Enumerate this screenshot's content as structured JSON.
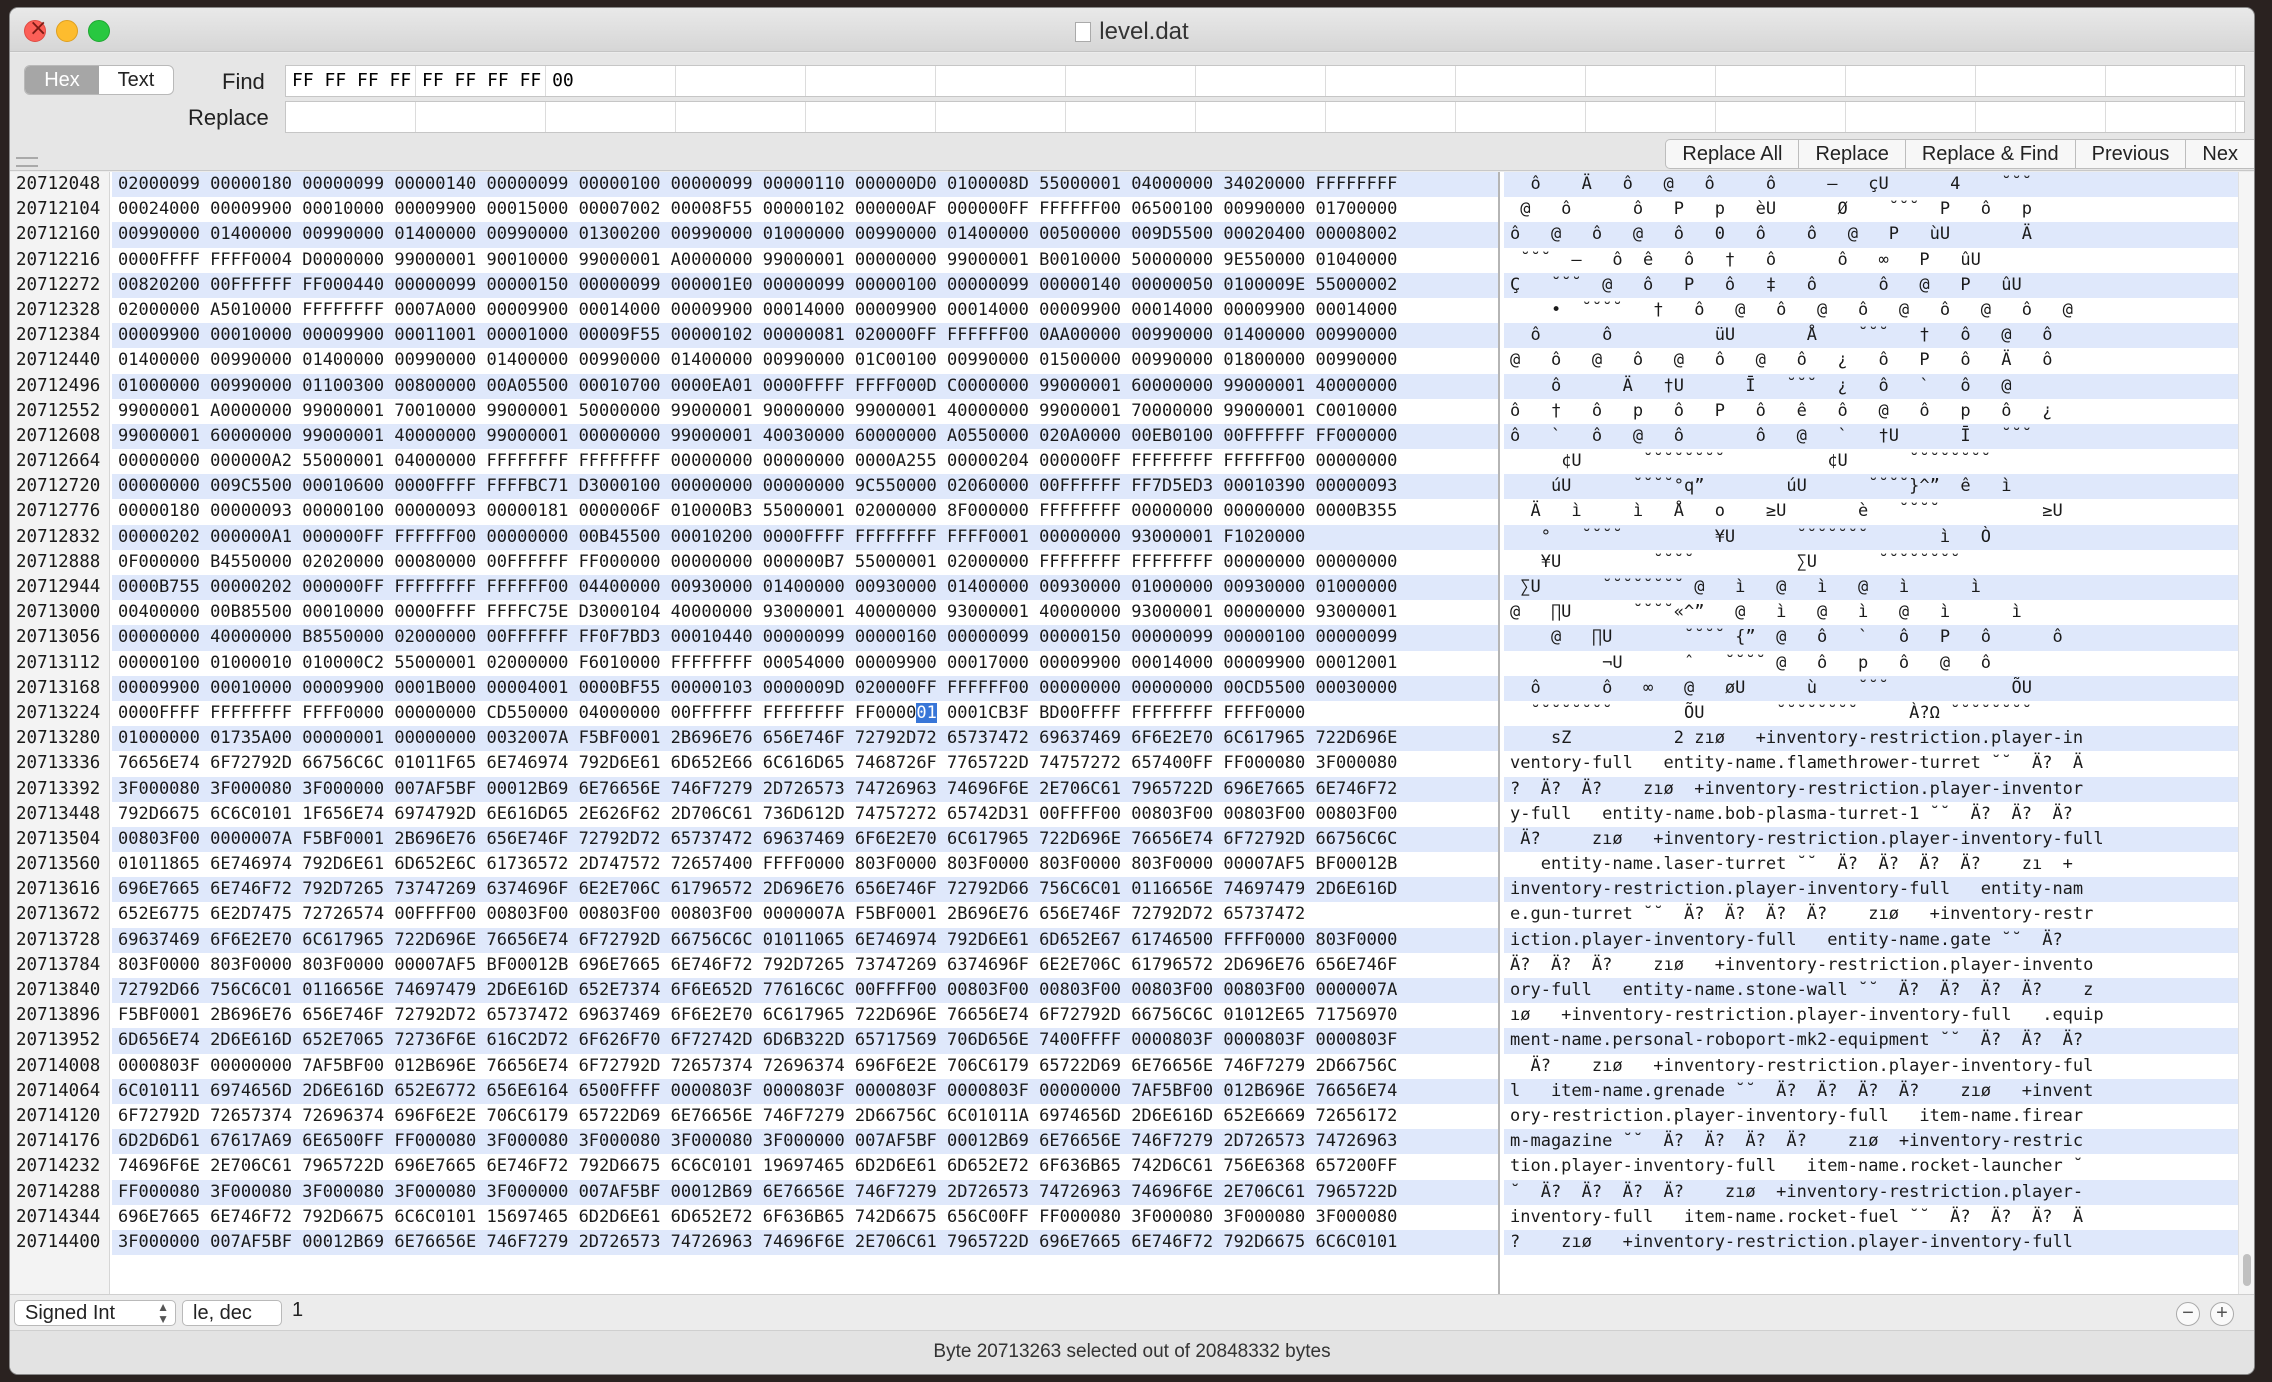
{
  "window": {
    "title": "level.dat"
  },
  "find": {
    "mode_hex": "Hex",
    "mode_text": "Text",
    "find_label": "Find",
    "find_value": "FF FF FF FF FF FF FF FF 00",
    "replace_label": "Replace",
    "replace_value": ""
  },
  "buttons": {
    "replace_all": "Replace All",
    "replace": "Replace",
    "replace_find": "Replace & Find",
    "previous": "Previous",
    "next": "Nex"
  },
  "rows": [
    {
      "o": "20712048",
      "h": "02000099 00000180 00000099 00000140 00000099 00000100 00000099 00000110 000000D0 0100008D 55000001 04000000 34020000 FFFFFFFF",
      "t": "  ô    Ä   ô   @   ô     ô     –   çU      4    ˘˘˘"
    },
    {
      "o": "20712104",
      "h": "00024000 00009900 00010000 00009900 00015000 00007002 00008F55 00000102 000000AF 000000FF FFFFFF00 06500100 00990000 01700000",
      "t": " @   ô      ô   P   p   èU      Ø    ˘˘˘  P   ô   p"
    },
    {
      "o": "20712160",
      "h": "00990000 01400000 00990000 01400000 00990000 01300200 00990000 01000000 00990000 01400000 00500000 009D5500 00020400 00008002",
      "t": "ô   @   ô   @   ô   0   ô    ô   @   P   ùU       Ä"
    },
    {
      "o": "20712216",
      "h": "0000FFFF FFFF0004 D0000000 99000001 90010000 99000001 A0000000 99000001 00000000 99000001 B0010000 50000000 9E550000 01040000",
      "t": " ˘˘˘  –   ô  ê   ô   †   ô      ô   ∞   P   ûU"
    },
    {
      "o": "20712272",
      "h": "00820200 00FFFFFF FF000440 00000099 00000150 00000099 000001E0 00000099 00000100 00000099 00000140 00000050 0100009E 55000002",
      "t": "Ç   ˘˘˘  @   ô   P   ô   ‡   ô      ô   @   P   ûU"
    },
    {
      "o": "20712328",
      "h": "02000000 A5010000 FFFFFFFF 0007A000 00009900 00014000 00009900 00014000 00009900 00014000 00009900 00014000 00009900 00014000",
      "t": "    •  ˘˘˘˘   †   ô   @   ô   @   ô   @   ô   @   ô   @"
    },
    {
      "o": "20712384",
      "h": "00009900 00010000 00009900 00011001 00001000 00009F55 00000102 00000081 020000FF FFFFFF00 0AA00000 00990000 01400000 00990000",
      "t": "  ô      ô          üU       Å    ˘˘˘   †   ô   @   ô"
    },
    {
      "o": "20712440",
      "h": "01400000 00990000 01400000 00990000 01400000 00990000 01400000 00990000 01C00100 00990000 01500000 00990000 01800000 00990000",
      "t": "@   ô   @   ô   @   ô   @   ô   ¿   ô   P   ô   Ä   ô"
    },
    {
      "o": "20712496",
      "h": "01000000 00990000 01100300 00800000 00A05500 00010700 0000EA01 0000FFFF FFFF000D C0000000 99000001 60000000 99000001 40000000",
      "t": "    ô      Ä   †U      Ī   ˘˘˘  ¿   ô   `   ô   @"
    },
    {
      "o": "20712552",
      "h": "99000001 A0000000 99000001 70010000 99000001 50000000 99000001 90000000 99000001 40000000 99000001 70000000 99000001 C0010000",
      "t": "ô   †   ô   p   ô   P   ô   ê   ô   @   ô   p   ô   ¿"
    },
    {
      "o": "20712608",
      "h": "99000001 60000000 99000001 40000000 99000001 00000000 99000001 40030000 60000000 A0550000 020A0000 00EB0100 00FFFFFF FF000000",
      "t": "ô   `   ô   @   ô       ô   @   `   †U      Ī   ˘˘˘"
    },
    {
      "o": "20712664",
      "h": "00000000 000000A2 55000001 04000000 FFFFFFFF FFFFFFFF 00000000 00000000 0000A255 00000204 000000FF FFFFFFFF FFFFFF00 00000000",
      "t": "     ¢U      ˘˘˘˘˘˘˘˘          ¢U      ˘˘˘˘˘˘˘˘"
    },
    {
      "o": "20712720",
      "h": "00000000 009C5500 00010600 0000FFFF FFFFBC71 D3000100 00000000 00000000 9C550000 02060000 00FFFFFF FF7D5ED3 00010390 00000093",
      "t": "    úU      ˘˘˘˘°q”        úU      ˘˘˘˘}^”  ê   ì"
    },
    {
      "o": "20712776",
      "h": "00000180 00000093 00000100 00000093 00000181 0000006F 010000B3 55000001 02000000 8F000000 FFFFFFFF 00000000 00000000 0000B355",
      "t": "  Ä   ì     ì   Å   o    ≥U       è   ˘˘˘˘          ≥U"
    },
    {
      "o": "20712832",
      "h": "00000202 000000A1 000000FF FFFFFF00 00000000 00B45500 00010200 0000FFFF FFFFFFFF FFFF0001 00000000 93000001 F1020000",
      "t": "   °   ˘˘˘˘         ¥U      ˘˘˘˘˘˘˘       ì   Ò"
    },
    {
      "o": "20712888",
      "h": "0F000000 B4550000 02020000 00080000 00FFFFFF FF000000 00000000 000000B7 55000001 02000000 FFFFFFFF FFFFFFFF 00000000 00000000",
      "t": "   ¥U         ˘˘˘˘          ∑U      ˘˘˘˘˘˘˘˘"
    },
    {
      "o": "20712944",
      "h": "0000B755 00000202 000000FF FFFFFFFF FFFFFF00 04400000 00930000 01400000 00930000 01400000 00930000 01000000 00930000 01000000",
      "t": " ∑U      ˘˘˘˘˘˘˘˘ @   ì   @   ì   @   ì      ì"
    },
    {
      "o": "20713000",
      "h": "00400000 00B85500 00010000 0000FFFF FFFFC75E D3000104 40000000 93000001 40000000 93000001 40000000 93000001 00000000 93000001",
      "t": "@   ∏U      ˘˘˘˘«^”   @   ì   @   ì   @   ì      ì"
    },
    {
      "o": "20713056",
      "h": "00000000 40000000 B8550000 02000000 00FFFFFF FF0F7BD3 00010440 00000099 00000160 00000099 00000150 00000099 00000100 00000099",
      "t": "    @   ∏U       ˘˘˘˘ {”  @   ô   `   ô   P   ô      ô"
    },
    {
      "o": "20713112",
      "h": "00000100 01000010 010000C2 55000001 02000000 F6010000 FFFFFFFF 00054000 00009900 00017000 00009900 00014000 00009900 00012001",
      "t": "         ¬U      ˆ   ˘˘˘˘ @   ô   p   ô   @   ô"
    },
    {
      "o": "20713168",
      "h": "00009900 00010000 00009900 0001B000 00004001 0000BF55 00000103 0000009D 020000FF FFFFFF00 00000000 00000000 00CD5500 00030000",
      "t": "  ô      ô   ∞   @   øU      ù    ˘˘˘            ÕU"
    },
    {
      "o": "20713224",
      "h": "0000FFFF FFFFFFFF FFFF0000 00000000 CD550000 04000000 00FFFFFF FFFFFFFF FF0000|01| 0001CB3F BD00FFFF FFFFFFFF FFFF0000",
      "t": "  ˘˘˘˘˘˘˘˘       ÕU       ˘˘˘˘˘˘˘˘     À?Ω ˘˘˘˘˘˘˘˘"
    },
    {
      "o": "20713280",
      "h": "01000000 01735A00 00000001 00000000 0032007A F5BF0001 2B696E76 656E746F 72792D72 65737472 69637469 6F6E2E70 6C617965 722D696E",
      "t": "    sZ          2 zıø   +inventory-restriction.player-in"
    },
    {
      "o": "20713336",
      "h": "76656E74 6F72792D 66756C6C 01011F65 6E746974 792D6E61 6D652E66 6C616D65 7468726F 7765722D 74757272 657400FF FF000080 3F000080",
      "t": "ventory-full   entity-name.flamethrower-turret ˘˘  Ä?  Ä"
    },
    {
      "o": "20713392",
      "h": "3F000080 3F000080 3F000000 007AF5BF 00012B69 6E76656E 746F7279 2D726573 74726963 74696F6E 2E706C61 7965722D 696E7665 6E746F72",
      "t": "?  Ä?  Ä?    zıø  +inventory-restriction.player-inventor"
    },
    {
      "o": "20713448",
      "h": "792D6675 6C6C0101 1F656E74 6974792D 6E616D65 2E626F62 2D706C61 736D612D 74757272 65742D31 00FFFF00 00803F00 00803F00 00803F00",
      "t": "y-full   entity-name.bob-plasma-turret-1 ˘˘  Ä?  Ä?  Ä?"
    },
    {
      "o": "20713504",
      "h": "00803F00 0000007A F5BF0001 2B696E76 656E746F 72792D72 65737472 69637469 6F6E2E70 6C617965 722D696E 76656E74 6F72792D 66756C6C",
      "t": " Ä?     zıø   +inventory-restriction.player-inventory-full"
    },
    {
      "o": "20713560",
      "h": "01011865 6E746974 792D6E61 6D652E6C 61736572 2D747572 72657400 FFFF0000 803F0000 803F0000 803F0000 803F0000 00007AF5 BF00012B",
      "t": "   entity-name.laser-turret ˘˘  Ä?  Ä?  Ä?  Ä?    zı  +"
    },
    {
      "o": "20713616",
      "h": "696E7665 6E746F72 792D7265 73747269 6374696F 6E2E706C 61796572 2D696E76 656E746F 72792D66 756C6C01 0116656E 74697479 2D6E616D",
      "t": "inventory-restriction.player-inventory-full   entity-nam"
    },
    {
      "o": "20713672",
      "h": "652E6775 6E2D7475 72726574 00FFFF00 00803F00 00803F00 00803F00 0000007A F5BF0001 2B696E76 656E746F 72792D72 65737472",
      "t": "e.gun-turret ˘˘  Ä?  Ä?  Ä?  Ä?    zıø   +inventory-restr"
    },
    {
      "o": "20713728",
      "h": "69637469 6F6E2E70 6C617965 722D696E 76656E74 6F72792D 66756C6C 01011065 6E746974 792D6E61 6D652E67 61746500 FFFF0000 803F0000",
      "t": "iction.player-inventory-full   entity-name.gate ˘˘  Ä?"
    },
    {
      "o": "20713784",
      "h": "803F0000 803F0000 803F0000 00007AF5 BF00012B 696E7665 6E746F72 792D7265 73747269 6374696F 6E2E706C 61796572 2D696E76 656E746F",
      "t": "Ä?  Ä?  Ä?    zıø   +inventory-restriction.player-invento"
    },
    {
      "o": "20713840",
      "h": "72792D66 756C6C01 0116656E 74697479 2D6E616D 652E7374 6F6E652D 77616C6C 00FFFF00 00803F00 00803F00 00803F00 00803F00 0000007A",
      "t": "ory-full   entity-name.stone-wall ˘˘  Ä?  Ä?  Ä?  Ä?    z"
    },
    {
      "o": "20713896",
      "h": "F5BF0001 2B696E76 656E746F 72792D72 65737472 69637469 6F6E2E70 6C617965 722D696E 76656E74 6F72792D 66756C6C 01012E65 71756970",
      "t": "ıø   +inventory-restriction.player-inventory-full   .equip"
    },
    {
      "o": "20713952",
      "h": "6D656E74 2D6E616D 652E7065 72736F6E 616C2D72 6F626F70 6F72742D 6D6B322D 65717569 706D656E 7400FFFF 0000803F 0000803F 0000803F",
      "t": "ment-name.personal-roboport-mk2-equipment ˘˘  Ä?  Ä?  Ä?"
    },
    {
      "o": "20714008",
      "h": "0000803F 00000000 7AF5BF00 012B696E 76656E74 6F72792D 72657374 72696374 696F6E2E 706C6179 65722D69 6E76656E 746F7279 2D66756C",
      "t": "  Ä?    zıø   +inventory-restriction.player-inventory-ful"
    },
    {
      "o": "20714064",
      "h": "6C010111 6974656D 2D6E616D 652E6772 656E6164 6500FFFF 0000803F 0000803F 0000803F 0000803F 00000000 7AF5BF00 012B696E 76656E74",
      "t": "l   item-name.grenade ˘˘  Ä?  Ä?  Ä?  Ä?    zıø   +invent"
    },
    {
      "o": "20714120",
      "h": "6F72792D 72657374 72696374 696F6E2E 706C6179 65722D69 6E76656E 746F7279 2D66756C 6C01011A 6974656D 2D6E616D 652E6669 72656172",
      "t": "ory-restriction.player-inventory-full   item-name.firear"
    },
    {
      "o": "20714176",
      "h": "6D2D6D61 67617A69 6E6500FF FF000080 3F000080 3F000080 3F000080 3F000000 007AF5BF 00012B69 6E76656E 746F7279 2D726573 74726963",
      "t": "m-magazine ˘˘  Ä?  Ä?  Ä?  Ä?    zıø  +inventory-restric"
    },
    {
      "o": "20714232",
      "h": "74696F6E 2E706C61 7965722D 696E7665 6E746F72 792D6675 6C6C0101 19697465 6D2D6E61 6D652E72 6F636B65 742D6C61 756E6368 657200FF",
      "t": "tion.player-inventory-full   item-name.rocket-launcher ˘"
    },
    {
      "o": "20714288",
      "h": "FF000080 3F000080 3F000080 3F000080 3F000000 007AF5BF 00012B69 6E76656E 746F7279 2D726573 74726963 74696F6E 2E706C61 7965722D",
      "t": "˘  Ä?  Ä?  Ä?  Ä?    zıø  +inventory-restriction.player-"
    },
    {
      "o": "20714344",
      "h": "696E7665 6E746F72 792D6675 6C6C0101 15697465 6D2D6E61 6D652E72 6F636B65 742D6675 656C00FF FF000080 3F000080 3F000080 3F000080",
      "t": "inventory-full   item-name.rocket-fuel ˘˘  Ä?  Ä?  Ä?  Ä"
    },
    {
      "o": "20714400",
      "h": "3F000000 007AF5BF 00012B69 6E76656E 746F7279 2D726573 74726963 74696F6E 2E706C61 7965722D 696E7665 6E746F72 792D6675 6C6C0101",
      "t": "?    zıø   +inventory-restriction.player-inventory-full"
    }
  ],
  "status": {
    "type_select": "Signed Int",
    "endian_select": "le, dec",
    "value": "1",
    "footer": "Byte 20713263 selected out of 20848332 bytes"
  },
  "icons": [
    "close-icon",
    "minimize-icon",
    "zoom-icon",
    "document-icon",
    "plus-icon",
    "minus-icon"
  ]
}
